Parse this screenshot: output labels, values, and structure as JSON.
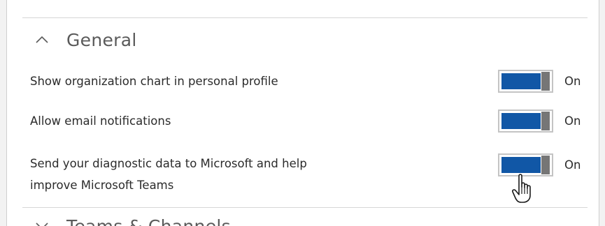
{
  "general_section": {
    "title": "General",
    "expanded": true,
    "icon": "chevron-up-icon",
    "settings": [
      {
        "label": "Show organization chart in personal profile",
        "state": "On",
        "enabled": true
      },
      {
        "label": "Allow email notifications",
        "state": "On",
        "enabled": true
      },
      {
        "label_line1": "Send your diagnostic data to Microsoft and help",
        "label_line2": "improve Microsoft Teams",
        "state": "On",
        "enabled": true
      }
    ]
  },
  "next_section": {
    "title": "Teams & Channels",
    "icon": "chevron-down-icon"
  },
  "colors": {
    "toggle_on": "#1157a6",
    "toggle_knob": "#767676",
    "title_text": "#5a5a5a"
  },
  "cursor": "hand-pointer-icon"
}
